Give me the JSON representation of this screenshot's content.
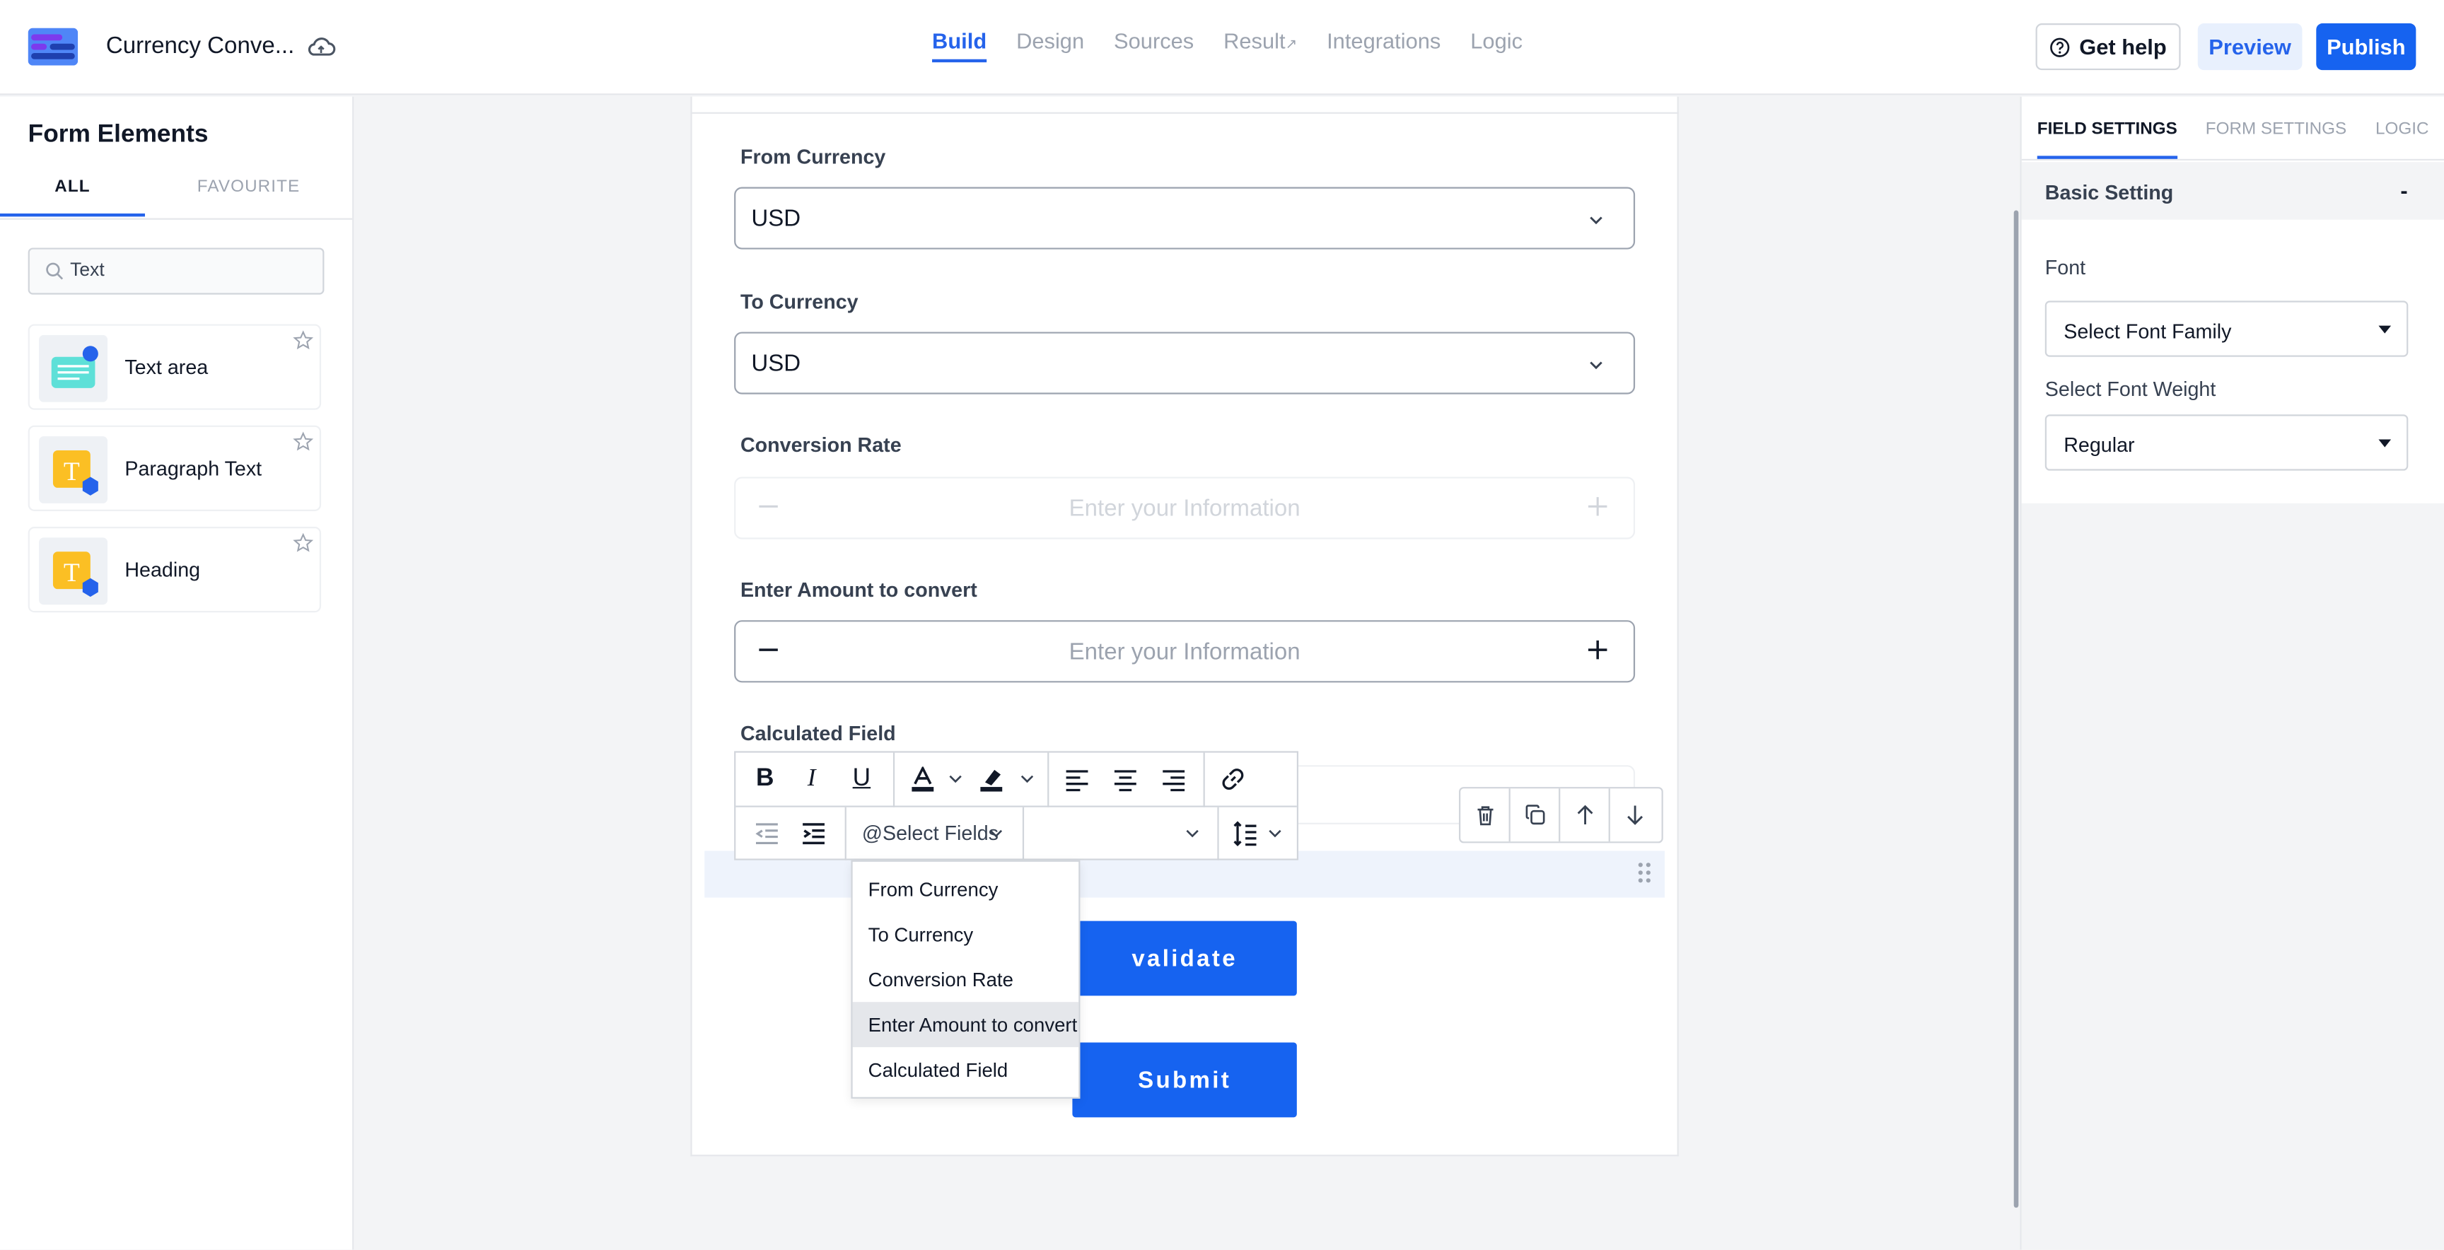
{
  "header": {
    "app_title": "Currency Conve...",
    "nav_tabs": [
      {
        "label": "Build",
        "active": true
      },
      {
        "label": "Design"
      },
      {
        "label": "Sources"
      },
      {
        "label": "Result"
      },
      {
        "label": "Integrations"
      },
      {
        "label": "Logic"
      }
    ],
    "get_help": "Get help",
    "preview": "Preview",
    "publish": "Publish"
  },
  "left": {
    "title": "Form Elements",
    "tabs": [
      "ALL",
      "FAVOURITE"
    ],
    "search_value": "Text",
    "elements": [
      {
        "label": "Text area",
        "icon": "text-area-icon"
      },
      {
        "label": "Paragraph Text",
        "icon": "paragraph-text-icon"
      },
      {
        "label": "Heading",
        "icon": "heading-icon"
      }
    ]
  },
  "form": {
    "fields": {
      "from_currency": {
        "label": "From Currency",
        "value": "USD"
      },
      "to_currency": {
        "label": "To Currency",
        "value": "USD"
      },
      "conversion_rate": {
        "label": "Conversion Rate",
        "placeholder": "Enter your Information"
      },
      "amount": {
        "label": "Enter Amount to convert",
        "placeholder": "Enter your Information"
      },
      "calculated": {
        "label": "Calculated Field"
      }
    },
    "toolbar": {
      "select_fields": "@Select Fields"
    },
    "dropdown_options": [
      "From Currency",
      "To Currency",
      "Conversion Rate",
      "Enter Amount to convert",
      "Calculated Field"
    ],
    "dropdown_highlighted": "Enter Amount to convert",
    "validate_label": "validate",
    "submit_label": "Submit"
  },
  "right": {
    "tabs": [
      "FIELD SETTINGS",
      "FORM SETTINGS",
      "LOGIC"
    ],
    "section_title": "Basic Setting",
    "collapse": "-",
    "font_label": "Font",
    "font_value": "Select Font Family",
    "weight_label": "Select Font Weight",
    "weight_value": "Regular"
  },
  "colors": {
    "accent": "#1663f0",
    "selected_row": "#eef3fc"
  }
}
